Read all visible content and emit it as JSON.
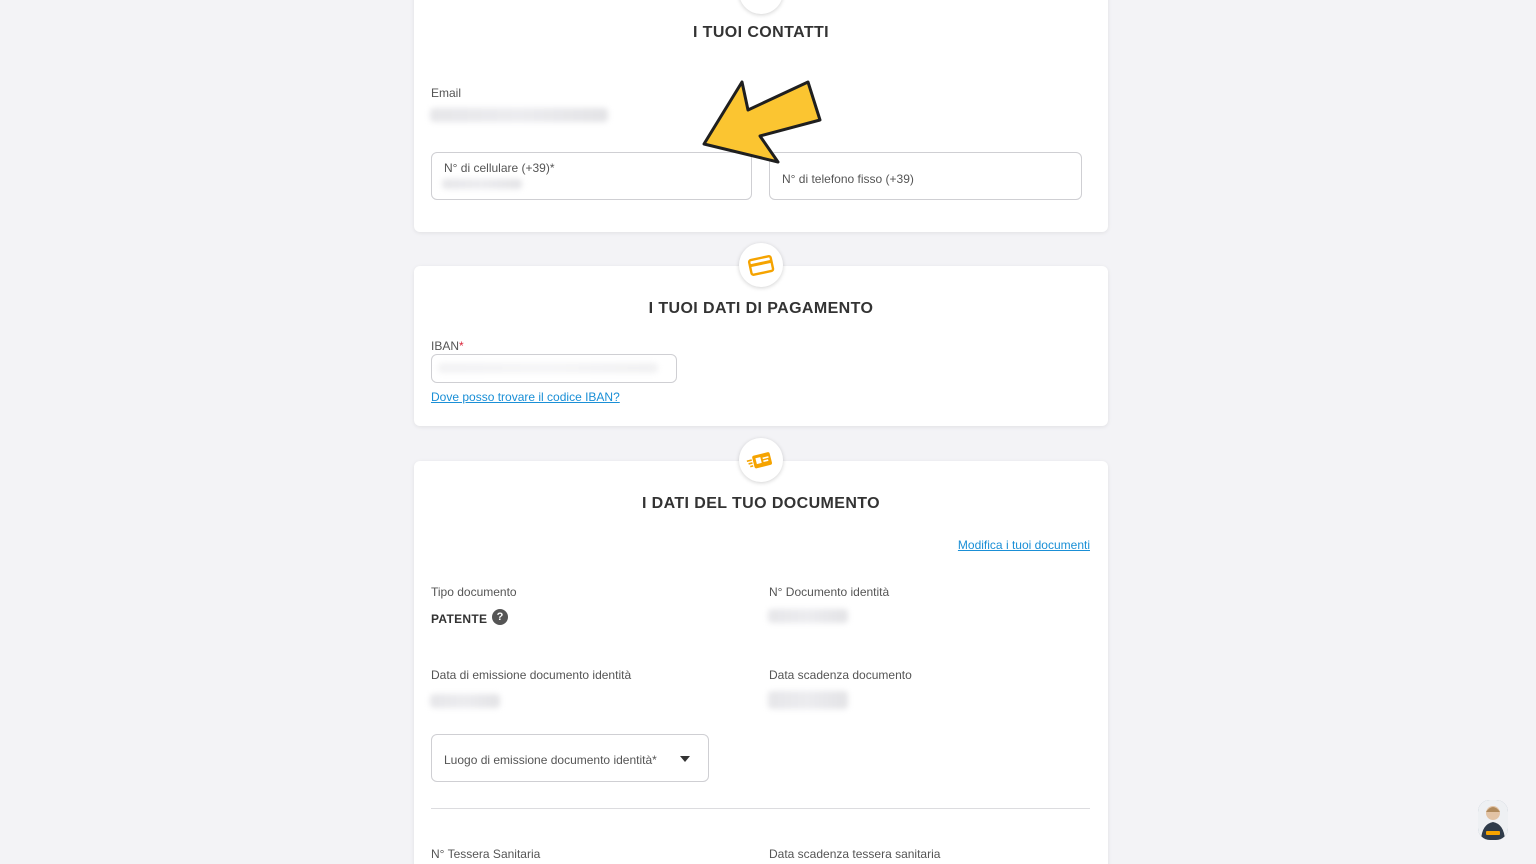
{
  "contacts": {
    "title": "I TUOI CONTATTI",
    "email_label": "Email",
    "mobile_label": "N° di cellulare (+39)",
    "mobile_required": "*",
    "landline_placeholder": "N° di telefono fisso (+39)"
  },
  "payment": {
    "title": "I TUOI DATI DI PAGAMENTO",
    "iban_label": "IBAN",
    "iban_required": "*",
    "iban_help_link": "Dove posso trovare il codice IBAN?"
  },
  "document": {
    "title": "I DATI DEL TUO DOCUMENTO",
    "edit_link": "Modifica i tuoi documenti",
    "doc_type_label": "Tipo documento",
    "doc_type_value": "PATENTE",
    "help_glyph": "?",
    "doc_number_label": "N° Documento identità",
    "issue_date_label": "Data di emissione documento identità",
    "expiry_date_label": "Data scadenza documento",
    "issue_place_label": "Luogo di emissione documento identità",
    "issue_place_required": "*",
    "health_card_label": "N° Tessera Sanitaria",
    "health_card_expiry_label": "Data scadenza tessera sanitaria"
  },
  "icons": {
    "contacts": "contact-icon",
    "payment": "credit-card-icon",
    "document": "id-document-icon",
    "dropdown": "chevron-down-icon",
    "annotation": "arrow-pointer-icon"
  },
  "colors": {
    "accent": "#f5a300",
    "link": "#1a8fd6",
    "required": "#d9263b",
    "arrow_fill": "#fbc531"
  }
}
